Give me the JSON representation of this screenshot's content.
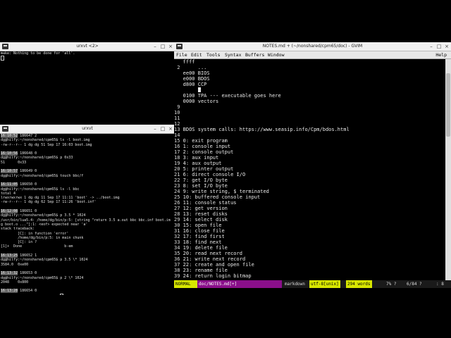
{
  "term_top": {
    "title": "urxvt <2>",
    "lines": [
      "make: Nothing to be done for 'all'."
    ]
  },
  "term_bottom": {
    "title": "urxvt",
    "lines": [
      [
        {
          "t": "16:10:52",
          "ts": true
        },
        {
          "t": " 186647 2"
        }
      ],
      [
        {
          "t": "dg@hilfy:~/nonshared/cpm65$ ls -l boot.img"
        }
      ],
      [
        {
          "t": "-rw-r--r-- 1 dg dg 51 Sep 17 16:03 boot.img"
        }
      ],
      [
        {
          "t": ""
        }
      ],
      [
        {
          "t": "16:10:56",
          "ts": true
        },
        {
          "t": " 186648 0"
        }
      ],
      [
        {
          "t": "dg@hilfy:~/nonshared/cpm65$ p 0x33"
        }
      ],
      [
        {
          "t": "51      0x33"
        }
      ],
      [
        {
          "t": ""
        }
      ],
      [
        {
          "t": "16:10:57",
          "ts": true
        },
        {
          "t": " 186649 0"
        }
      ],
      [
        {
          "t": "dg@hilfy:~/nonshared/cpm65$ touch bbc/f"
        }
      ],
      [
        {
          "t": ""
        }
      ],
      [
        {
          "t": "16:11:05",
          "ts": true
        },
        {
          "t": " 186650 0"
        }
      ],
      [
        {
          "t": "dg@hilfy:~/nonshared/cpm65$ ls -l bbc"
        }
      ],
      [
        {
          "t": "total 4"
        }
      ],
      [
        {
          "t": "lrwxrwxrwx 1 dg dg 11 Sep 17 11:11 'boot' -> ../boot.img"
        }
      ],
      [
        {
          "t": "-rw-r--r-- 1 dg dg 62 Sep 17 11:26 'boot.inf'"
        }
      ],
      [
        {
          "t": ""
        }
      ],
      [
        {
          "t": "16:12:08",
          "ts": true
        },
        {
          "t": " 186651 0"
        }
      ],
      [
        {
          "t": "dg@hilfy:~/nonshared/cpm65$ p 3.5 * 1024"
        }
      ],
      [
        {
          "t": "/usr/bin/lua5.4: /home/dg/bin/p:5: [string \"return 3.5 a.out bbc bbc.inf boot.im"
        }
      ],
      [
        {
          "t": "g boot.o ...\"]:1: <eof> expected near 'a'"
        }
      ],
      [
        {
          "t": "stack traceback:"
        }
      ],
      [
        {
          "t": "        [C]: in function 'error'"
        }
      ],
      [
        {
          "t": "        /home/dg/bin/p:5: in main chunk"
        }
      ],
      [
        {
          "t": "        [C]: in ?"
        }
      ],
      [
        {
          "t": "[1]+  Done                    b-em"
        }
      ],
      [
        {
          "t": ""
        }
      ],
      [
        {
          "t": "16:13:25",
          "ts": true
        },
        {
          "t": " 186652 1"
        }
      ],
      [
        {
          "t": "dg@hilfy:~/nonshared/cpm65$ p 3.5 \\* 1024"
        }
      ],
      [
        {
          "t": "3584.0  0xe00"
        }
      ],
      [
        {
          "t": ""
        }
      ],
      [
        {
          "t": "16:13:32",
          "ts": true
        },
        {
          "t": " 186653 0"
        }
      ],
      [
        {
          "t": "dg@hilfy:~/nonshared/cpm65$ p 2 \\* 1024"
        }
      ],
      [
        {
          "t": "2048    0x800"
        }
      ],
      [
        {
          "t": ""
        }
      ],
      [
        {
          "t": "16:13:28",
          "ts": true
        },
        {
          "t": " 186654 0"
        }
      ],
      [
        {
          "t": "dg@hilfy:~/nonshared/cpm65$ ",
          "cursor": true
        }
      ]
    ]
  },
  "gvim": {
    "title": "NOTES.md + (~/nonshared/cpm65/doc) - GVIM",
    "menu": [
      "File",
      "Edit",
      "Tools",
      "Syntax",
      "Buffers",
      "Window",
      "Help"
    ],
    "lines": [
      {
        "n": "",
        "t": "ffff"
      },
      {
        "n": "2",
        "t": "     ..."
      },
      {
        "n": "",
        "t": "ee00 BIOS"
      },
      {
        "n": "",
        "t": "e000 BDOS"
      },
      {
        "n": "",
        "t": "d800 CCP"
      },
      {
        "n": "",
        "t": "     ",
        "cursor": true
      },
      {
        "n": "",
        "t": "0100 TPA --- executable goes here"
      },
      {
        "n": "",
        "t": "0000 vectors"
      },
      {
        "n": "9",
        "t": ""
      },
      {
        "n": "10",
        "t": ""
      },
      {
        "n": "11",
        "t": ""
      },
      {
        "n": "12",
        "t": ""
      },
      {
        "n": "13",
        "t": "BDOS system calls: https://www.seasip.info/Cpm/bdos.html"
      },
      {
        "n": "14",
        "t": ""
      },
      {
        "n": "15",
        "t": "0: exit program"
      },
      {
        "n": "16",
        "t": "1: console input"
      },
      {
        "n": "17",
        "t": "2: console output"
      },
      {
        "n": "18",
        "t": "3: aux input"
      },
      {
        "n": "19",
        "t": "4: aux output"
      },
      {
        "n": "20",
        "t": "5: printer output"
      },
      {
        "n": "21",
        "t": "6: direct console I/O"
      },
      {
        "n": "22",
        "t": "7: get I/O byte"
      },
      {
        "n": "23",
        "t": "8: set I/O byte"
      },
      {
        "n": "24",
        "t": "9: write string, $ terminated"
      },
      {
        "n": "25",
        "t": "10: buffered console input"
      },
      {
        "n": "26",
        "t": "11: console status"
      },
      {
        "n": "27",
        "t": "12: get version"
      },
      {
        "n": "28",
        "t": "13: reset disks"
      },
      {
        "n": "29",
        "t": "14: select disk"
      },
      {
        "n": "30",
        "t": "15: open file"
      },
      {
        "n": "31",
        "t": "16: close file"
      },
      {
        "n": "32",
        "t": "17: find first"
      },
      {
        "n": "33",
        "t": "18: find next"
      },
      {
        "n": "34",
        "t": "19: delete file"
      },
      {
        "n": "35",
        "t": "20: read next record"
      },
      {
        "n": "36",
        "t": "21: write next record"
      },
      {
        "n": "37",
        "t": "22: create and open file"
      },
      {
        "n": "38",
        "t": "23: rename file"
      },
      {
        "n": "39",
        "t": "24: return login bitmap"
      }
    ],
    "status": {
      "mode": "NORMAL",
      "file": "doc/NOTES.md[+]",
      "filetype": "markdown",
      "encoding": "utf-8[unix]",
      "words": "294 words",
      "percent": "7% ?",
      "position": "6/84 ?",
      "column": ": 8"
    },
    "colors": {
      "mode_bg": "#d7e600",
      "file_bg": "#8a0f8a",
      "encoding_bg": "#d7e600",
      "words_bg": "#d7e600"
    }
  },
  "icons": [
    "terminal-icon",
    "minimize-icon",
    "maximize-icon",
    "close-icon"
  ]
}
